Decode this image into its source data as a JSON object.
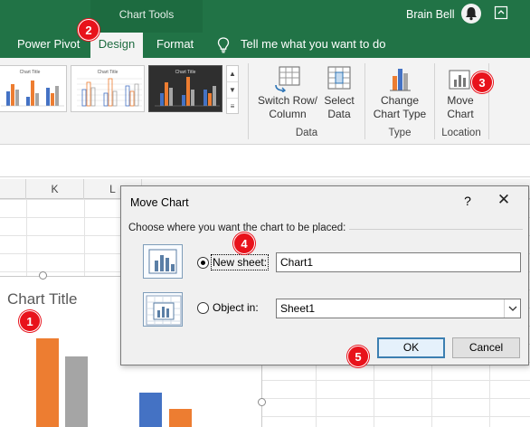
{
  "titlebar": {
    "context_label": "Chart Tools",
    "user_name": "Brain Bell"
  },
  "tabs": {
    "power_pivot": "Power Pivot",
    "design": "Design",
    "format": "Format",
    "tell_me": "Tell me what you want to do"
  },
  "ribbon": {
    "gallery_thumb_title": "Chart Title",
    "switch_row_col": [
      "Switch Row/",
      "Column"
    ],
    "select_data": [
      "Select",
      "Data"
    ],
    "change_chart_type": [
      "Change",
      "Chart Type"
    ],
    "move_chart": [
      "Move",
      "Chart"
    ],
    "group_data": "Data",
    "group_type": "Type",
    "group_location": "Location"
  },
  "columns": [
    "K",
    "L"
  ],
  "chart": {
    "title": "Chart Title",
    "colors": {
      "orange": "#ed7d31",
      "gray": "#a5a5a5",
      "blue": "#4472c4"
    }
  },
  "dialog": {
    "title": "Move Chart",
    "help": "?",
    "close": "✕",
    "heading": "Choose where you want the chart to be placed:",
    "new_sheet_label": "New sheet:",
    "new_sheet_value": "Chart1",
    "object_in_label": "Object in:",
    "object_in_value": "Sheet1",
    "ok": "OK",
    "cancel": "Cancel",
    "selected_option": "new_sheet"
  },
  "callouts": [
    "1",
    "2",
    "3",
    "4",
    "5"
  ],
  "colors": {
    "excel_green": "#217346",
    "callout_red": "#e8121b"
  }
}
